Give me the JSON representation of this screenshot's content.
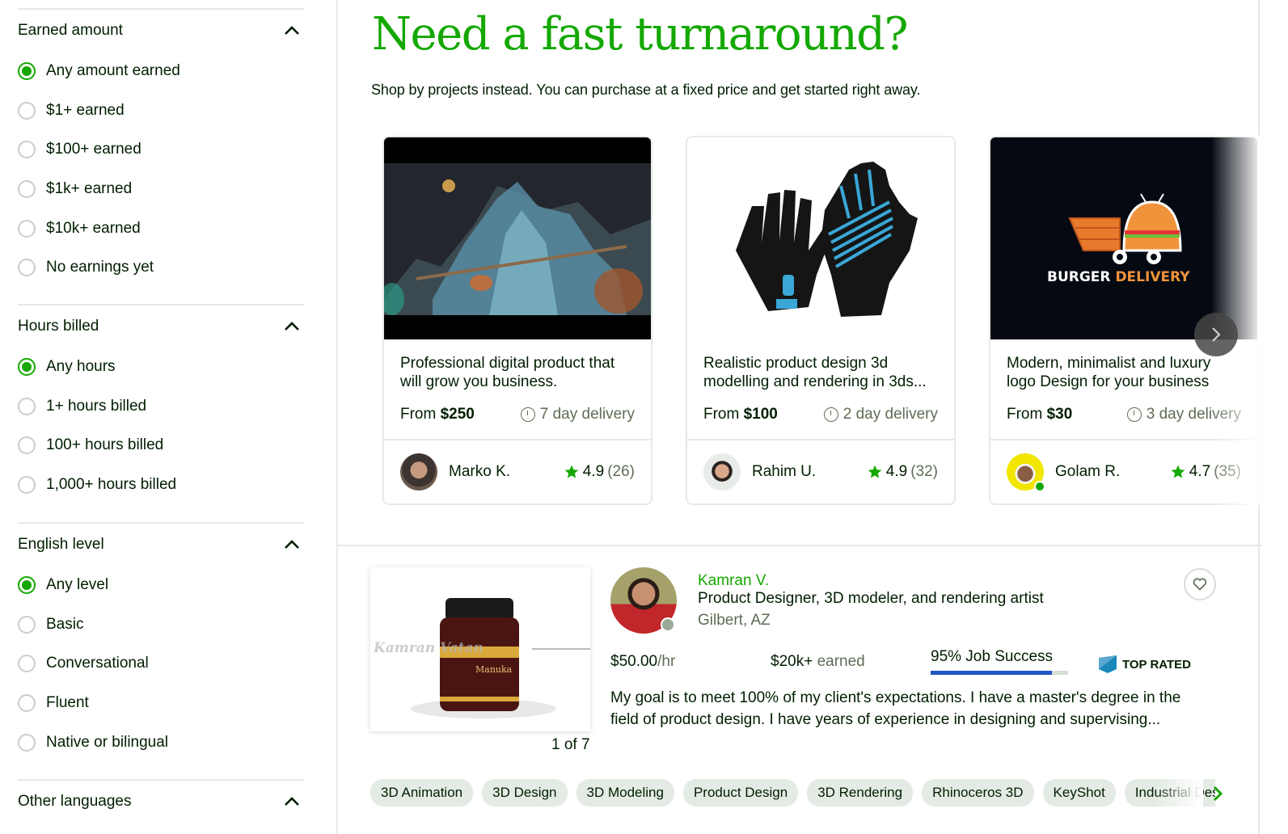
{
  "sidebar": {
    "sections": [
      {
        "title": "Earned amount",
        "options": [
          {
            "label": "Any amount earned",
            "checked": true
          },
          {
            "label": "$1+ earned",
            "checked": false
          },
          {
            "label": "$100+ earned",
            "checked": false
          },
          {
            "label": "$1k+ earned",
            "checked": false
          },
          {
            "label": "$10k+ earned",
            "checked": false
          },
          {
            "label": "No earnings yet",
            "checked": false
          }
        ]
      },
      {
        "title": "Hours billed",
        "options": [
          {
            "label": "Any hours",
            "checked": true
          },
          {
            "label": "1+ hours billed",
            "checked": false
          },
          {
            "label": "100+ hours billed",
            "checked": false
          },
          {
            "label": "1,000+ hours billed",
            "checked": false
          }
        ]
      },
      {
        "title": "English level",
        "options": [
          {
            "label": "Any level",
            "checked": true
          },
          {
            "label": "Basic",
            "checked": false
          },
          {
            "label": "Conversational",
            "checked": false
          },
          {
            "label": "Fluent",
            "checked": false
          },
          {
            "label": "Native or bilingual",
            "checked": false
          }
        ]
      },
      {
        "title": "Other languages",
        "options": []
      }
    ]
  },
  "hero": {
    "title": "Need a fast turnaround?",
    "subtitle": "Shop by projects instead. You can purchase at a fixed price and get started right away."
  },
  "projects": [
    {
      "title": "Professional digital product that will grow you business.",
      "price_prefix": "From ",
      "price": "$250",
      "delivery": "7 day delivery",
      "seller": "Marko K.",
      "rating": "4.9",
      "reviews": "(26)",
      "online": false
    },
    {
      "title": "Realistic product design 3d modelling and rendering in 3ds...",
      "price_prefix": "From ",
      "price": "$100",
      "delivery": "2 day delivery",
      "seller": "Rahim U.",
      "rating": "4.9",
      "reviews": "(32)",
      "online": false
    },
    {
      "title": "Modern, minimalist and luxury logo Design for your business",
      "price_prefix": "From ",
      "price": "$30",
      "delivery": "3 day delivery",
      "seller": "Golam R.",
      "rating": "4.7",
      "reviews": "(35)",
      "online": true,
      "image_text_a": "BURGER ",
      "image_text_b": "DELIVERY"
    }
  ],
  "freelancer": {
    "name": "Kamran V.",
    "title": "Product Designer, 3D modeler, and rendering artist",
    "location": "Gilbert, AZ",
    "rate": "$50.00",
    "rate_unit": "/hr",
    "earned": "$20k+",
    "earned_suffix": " earned",
    "job_success_label": "95% Job Success",
    "job_success_percent": 95,
    "badge": "TOP RATED",
    "description": "My goal is to meet 100% of my client's expectations. I have a master's degree in the field of product design. I have years of experience in designing and supervising...",
    "portfolio_counter": "1 of 7",
    "portfolio_watermark": "Kamran Vatan",
    "skills": [
      "3D Animation",
      "3D Design",
      "3D Modeling",
      "Product Design",
      "3D Rendering",
      "Rhinoceros 3D",
      "KeyShot",
      "Industrial Design"
    ]
  },
  "colors": {
    "brand_green": "#14a800",
    "jss_blue": "#1f57c3",
    "top_rated_blue": "#1a88b8",
    "star": "#14a800"
  }
}
